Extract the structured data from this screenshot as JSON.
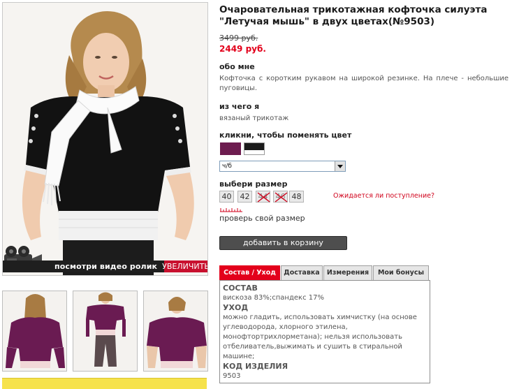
{
  "product": {
    "title": "Очаровательная трикотажная кофточка силуэта \"Летучая мышь\" в двух цветах(№9503)",
    "old_price": "3499 руб.",
    "new_price": "2449 руб."
  },
  "media": {
    "video_label": "посмотри видео ролик",
    "zoom_label": "УВЕЛИЧИТЬ"
  },
  "about": {
    "heading": "обо мне",
    "text": "Кофточка с коротким рукавом на широкой резинке. На плече - небольшие пуговицы."
  },
  "material": {
    "heading": "из чего я",
    "text": "вязаный трикотаж"
  },
  "color": {
    "heading": "кликни, чтобы поменять цвет",
    "selected": "ч/б",
    "swatches": [
      "#6d1c4f",
      "#1b1b1b"
    ]
  },
  "size": {
    "heading": "выбери размер",
    "options": [
      {
        "label": "40",
        "available": true
      },
      {
        "label": "42",
        "available": true
      },
      {
        "label": "44",
        "available": false
      },
      {
        "label": "46",
        "available": false
      },
      {
        "label": "48",
        "available": true
      }
    ],
    "notify_link": "Ожидается ли поступление?",
    "check_link": "проверь свой размер"
  },
  "cart": {
    "add_label": "добавить в корзину"
  },
  "tabs": {
    "items": [
      "Состав / Уход",
      "Доставка",
      "Измерения",
      "Мои бонусы"
    ],
    "active": 0,
    "content": {
      "composition_h": "СОСТАВ",
      "composition_t": "вискоза 83%;спандекс 17%",
      "care_h": "УХОД",
      "care_t": "можно гладить, использовать химчистку (на основе углеводорода, хлорного этилена, монофтортрихлорметана); нельзя использовать отбеливатель,выжимать и сушить в стиральной машине;",
      "code_h": "КОД ИЗДЕЛИЯ",
      "code_t": "9503"
    }
  },
  "colors": {
    "accent_red": "#e3001b",
    "button_dark": "#4e4e4e"
  }
}
